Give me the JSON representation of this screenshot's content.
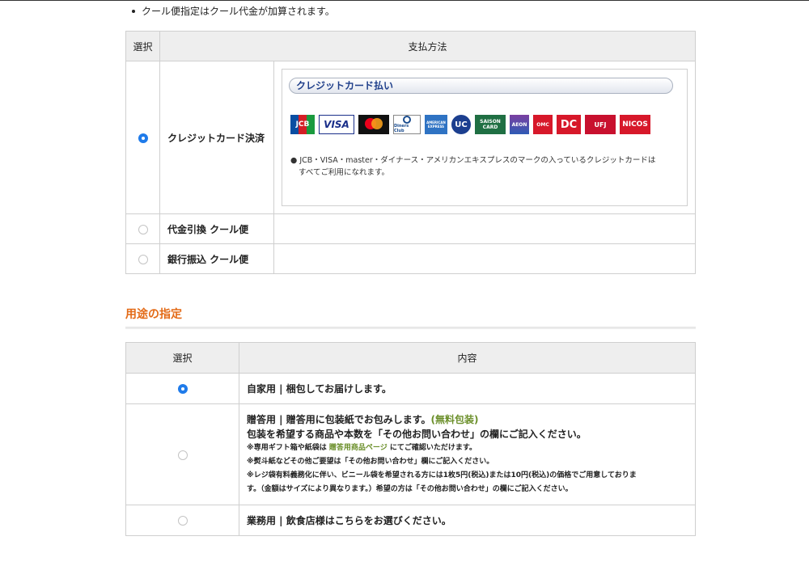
{
  "note": "クール便指定はクール代金が加算されます。",
  "payment_table": {
    "col_select": "選択",
    "col_method": "支払方法",
    "rows": [
      {
        "label": "クレジットカード決済",
        "selected": true
      },
      {
        "label": "代金引換 クール便",
        "selected": false
      },
      {
        "label": "銀行振込 クール便",
        "selected": false
      }
    ],
    "credit_box": {
      "title": "クレジットカード払い",
      "desc_line1": "JCB・VISA・master・ダイナース・アメリカンエキスプレスのマークの入っているクレジットカードは",
      "desc_line2": "すべてご利用になれます。",
      "logos": [
        "JCB",
        "VISA",
        "mastercard",
        "Diners Club",
        "AMERICAN EXPRESS",
        "UC",
        "SAISON CARD",
        "AEON",
        "OMC",
        "DC",
        "UFJ",
        "NICOS"
      ]
    }
  },
  "usage": {
    "section_title": "用途の指定",
    "col_select": "選択",
    "col_content": "内容",
    "rows": {
      "home": "自家用 | 梱包してお届けします。",
      "gift_line1": "贈答用 | 贈答用に包装紙でお包みします。",
      "gift_free": "(無料包装)",
      "gift_line2": "包装を希望する商品や本数を「その他お問い合わせ」の欄にご記入ください。",
      "gift_note1_a": "※専用ギフト箱や紙袋は",
      "gift_note1_link": "贈答用商品ページ",
      "gift_note1_b": "にてご確認いただけます。",
      "gift_note2": "※熨斗紙などその他ご要望は「その他お問い合わせ」欄にご記入ください。",
      "gift_note3": "※レジ袋有料義務化に伴い、ビニール袋を希望される方には1枚5円(税込)または10円(税込)の価格でご用意しておりま",
      "gift_note4": "す。（金額はサイズにより異なります。）希望の方は「その他お問い合わせ」の欄にご記入ください。",
      "business": "業務用 | 飲食店様はこちらをお選びください。"
    },
    "selected": "home"
  }
}
